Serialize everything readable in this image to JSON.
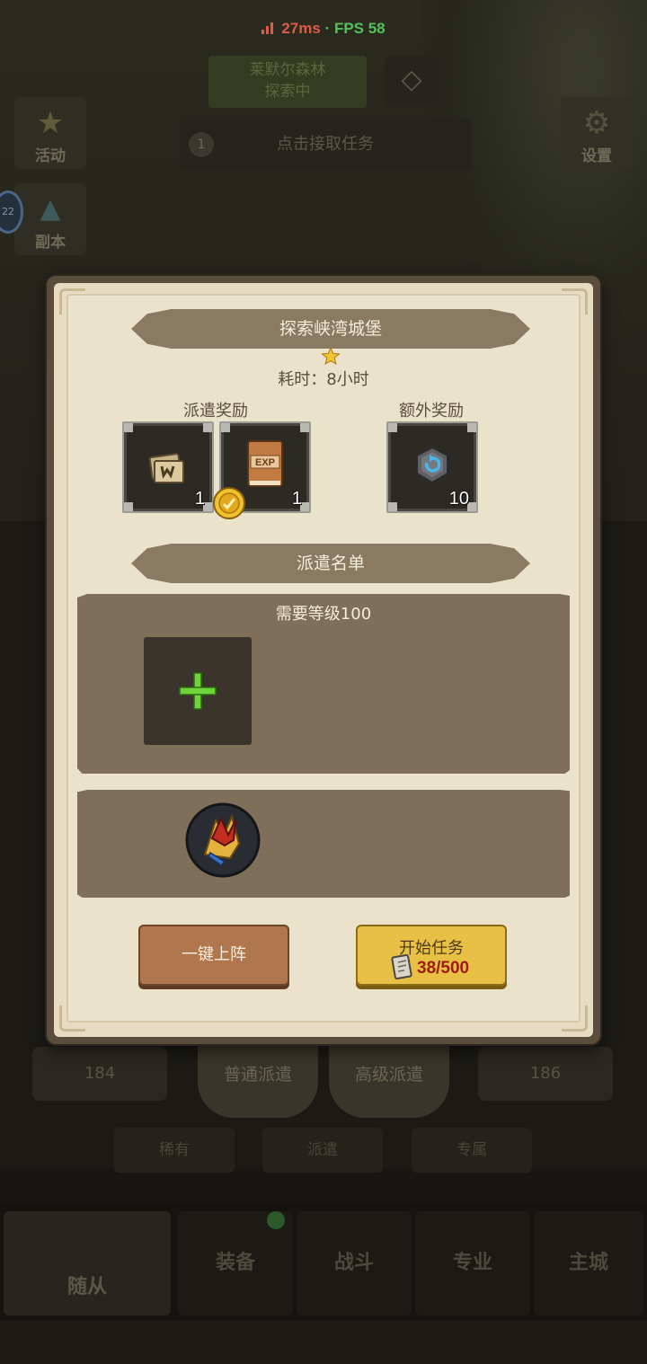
{
  "status_bar": {
    "ping": "27ms",
    "separator": " · ",
    "fps": "FPS 58"
  },
  "background": {
    "zone_name": "莱默尔森林",
    "zone_sub": "探索中",
    "task_hint": "点击接取任务",
    "task_count": "1",
    "events_label": "活动",
    "dungeon_label": "副本",
    "settings_label": "设置",
    "player_level": "22",
    "slot_levels": [
      "184",
      "186"
    ],
    "dispatch_tabs": [
      "普通派遣",
      "高级派遣"
    ],
    "filters": [
      "稀有",
      "派遣",
      "专属"
    ],
    "nav": [
      "随从",
      "装备",
      "战斗",
      "专业",
      "主城"
    ]
  },
  "dialog": {
    "title": "探索峡湾城堡",
    "stars": 1,
    "duration": "耗时：8小时",
    "dispatch_reward_label": "派遣奖励",
    "extra_reward_label": "额外奖励",
    "rewards": [
      {
        "icon": "scroll-bundle-icon",
        "qty": "1"
      },
      {
        "icon": "exp-book-icon",
        "qty": "1"
      }
    ],
    "extra_rewards": [
      {
        "icon": "gear-stone-icon",
        "qty": "10"
      }
    ],
    "roster_label": "派遣名单",
    "requirement": "需要等级100",
    "auto_deploy_label": "一键上阵",
    "start_label": "开始任务",
    "cost": "38/500"
  },
  "colors": {
    "accent_yellow": "#e8c046",
    "panel_brown": "#7f6f59",
    "paper": "#ebe2cb",
    "plus_green": "#6fd43a"
  }
}
